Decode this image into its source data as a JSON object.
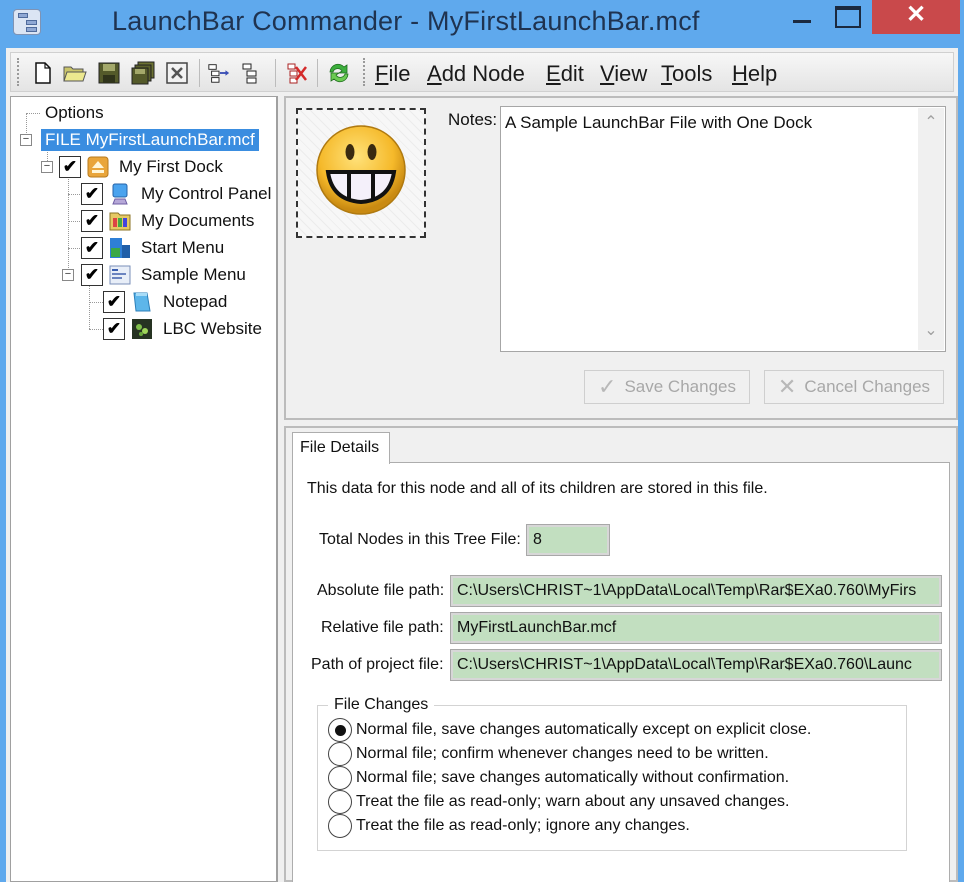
{
  "window": {
    "title": "LaunchBar Commander - MyFirstLaunchBar.mcf",
    "close_glyph": "✕"
  },
  "toolbar": {
    "buttons": [
      {
        "name": "new-file",
        "icon": "new-file-icon"
      },
      {
        "name": "open-file",
        "icon": "open-folder-icon"
      },
      {
        "name": "save-file",
        "icon": "floppy-disk-icon"
      },
      {
        "name": "save-all",
        "icon": "save-all-icon"
      },
      {
        "name": "close-file",
        "icon": "close-box-icon"
      },
      {
        "name": "add-child-node",
        "icon": "add-child-node-icon"
      },
      {
        "name": "add-sibling-node",
        "icon": "add-sibling-node-icon"
      },
      {
        "name": "delete-node",
        "icon": "delete-node-icon"
      },
      {
        "name": "refresh",
        "icon": "refresh-icon"
      }
    ]
  },
  "menu": [
    {
      "key": "F",
      "rest": "ile"
    },
    {
      "key": "A",
      "rest": "dd Node"
    },
    {
      "key": "E",
      "rest": "dit"
    },
    {
      "key": "V",
      "rest": "iew"
    },
    {
      "key": "T",
      "rest": "ools"
    },
    {
      "key": "H",
      "rest": "elp"
    }
  ],
  "tree": {
    "items": [
      {
        "label": "Options",
        "checked": null,
        "icon": "none"
      },
      {
        "label": "FILE MyFirstLaunchBar.mcf",
        "checked": null,
        "selected": true,
        "expanded": true
      },
      {
        "label": "My First Dock",
        "checked": true,
        "icon": "dock-icon",
        "expanded": true
      },
      {
        "label": "My Control Panel",
        "checked": true,
        "icon": "control-panel-icon"
      },
      {
        "label": "My Documents",
        "checked": true,
        "icon": "documents-folder-icon"
      },
      {
        "label": "Start Menu",
        "checked": true,
        "icon": "start-menu-icon"
      },
      {
        "label": "Sample Menu",
        "checked": true,
        "icon": "menu-icon",
        "expanded": true
      },
      {
        "label": "Notepad",
        "checked": true,
        "icon": "notepad-icon"
      },
      {
        "label": "LBC Website",
        "checked": true,
        "icon": "website-icon"
      }
    ],
    "check_glyph": "✔",
    "collapse_glyph": "−"
  },
  "node_editor": {
    "node_icon": "grinning-smiley-icon",
    "notes_label": "Notes:",
    "notes_value": "A Sample LaunchBar File with One Dock",
    "save_label": "Save Changes",
    "cancel_label": "Cancel Changes",
    "save_glyph": "✓",
    "cancel_glyph": "✕",
    "scroll_up": "⌃",
    "scroll_down": "⌄"
  },
  "file_details": {
    "tab_label": "File Details",
    "description": "This data for this node and all of its children are stored in this file.",
    "total_nodes_label": "Total Nodes in this Tree File:",
    "total_nodes_value": "8",
    "absolute_path_label": "Absolute file path:",
    "absolute_path_value": "C:\\Users\\CHRIST~1\\AppData\\Local\\Temp\\Rar$EXa0.760\\MyFirs",
    "relative_path_label": "Relative file path:",
    "relative_path_value": "MyFirstLaunchBar.mcf",
    "project_path_label": "Path of project file:",
    "project_path_value": "C:\\Users\\CHRIST~1\\AppData\\Local\\Temp\\Rar$EXa0.760\\Launc",
    "file_changes": {
      "legend": "File Changes",
      "options": [
        {
          "label": "Normal file, save changes automatically except on explicit close.",
          "selected": true
        },
        {
          "label": "Normal file; confirm whenever changes need to be written.",
          "selected": false
        },
        {
          "label": "Normal file; save changes automatically without confirmation.",
          "selected": false
        },
        {
          "label": "Treat the file as read-only; warn about any unsaved changes.",
          "selected": false
        },
        {
          "label": "Treat the file as read-only; ignore any changes.",
          "selected": false
        }
      ]
    }
  }
}
